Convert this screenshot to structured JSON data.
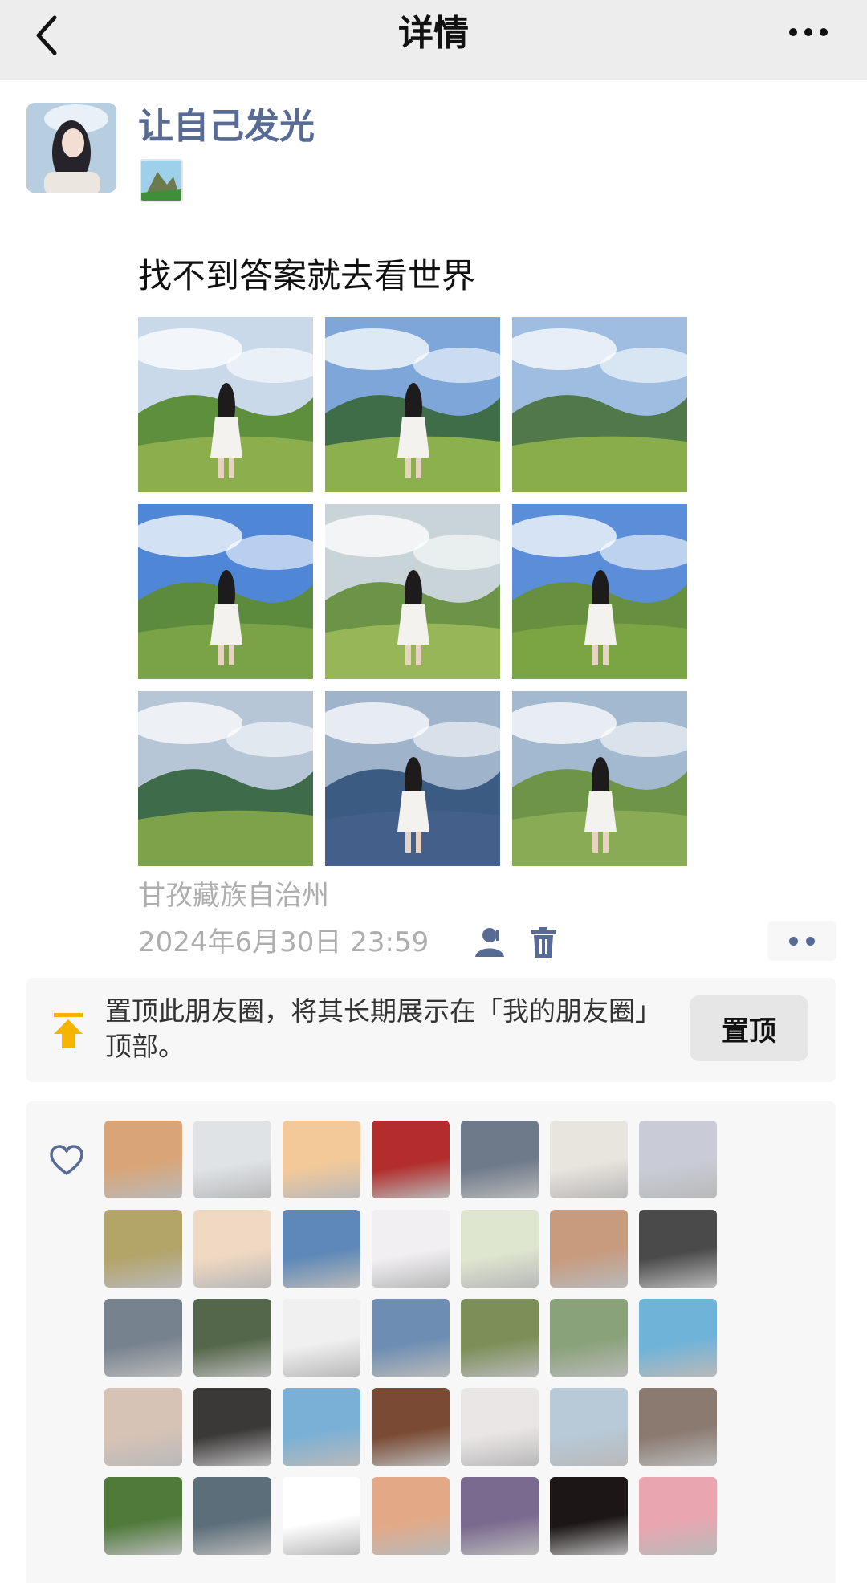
{
  "navbar": {
    "title": "详情",
    "back_icon": "chevron-left-icon",
    "more_icon": "more-dots-icon"
  },
  "post": {
    "author_name": "让自己发光",
    "status_icon": "landscape-status-icon",
    "text": "找不到答案就去看世界",
    "photos": [
      {
        "sky": "#c9d9ea",
        "hill": "#5e8f3c",
        "ground": "#8cae4c",
        "figure": true
      },
      {
        "sky": "#7ea6d9",
        "hill": "#3f6d48",
        "ground": "#8db04f",
        "figure": true
      },
      {
        "sky": "#9fbde0",
        "hill": "#50784a",
        "ground": "#88ad4a",
        "figure": false
      },
      {
        "sky": "#4f87d6",
        "hill": "#5d8b3e",
        "ground": "#7aa246",
        "figure": true
      },
      {
        "sky": "#c9d4d8",
        "hill": "#6b9446",
        "ground": "#96b658",
        "figure": true
      },
      {
        "sky": "#5b8ed8",
        "hill": "#66903f",
        "ground": "#7ba443",
        "figure": true
      },
      {
        "sky": "#b6c6d6",
        "hill": "#3e6c4a",
        "ground": "#7ea24a",
        "figure": false
      },
      {
        "sky": "#9fb3cb",
        "hill": "#3c5b82",
        "ground": "#44608a",
        "figure": true
      },
      {
        "sky": "#a3b9cf",
        "hill": "#6e9547",
        "ground": "#8aab56",
        "figure": true
      }
    ],
    "location": "甘孜藏族自治州",
    "timestamp": "2024年6月30日 23:59",
    "privacy_icon": "person-icon",
    "delete_icon": "trash-icon",
    "more_icon": "two-dots-icon"
  },
  "pin": {
    "icon": "pin-top-icon",
    "text": "置顶此朋友圈，将其长期展示在「我的朋友圈」顶部。",
    "button_label": "置顶"
  },
  "likes": {
    "icon": "heart-icon",
    "avatar_colors": [
      "#d9a577",
      "#dfe3e6",
      "#f3c99a",
      "#b22d2b",
      "#6e7a8a",
      "#e8e4de",
      "#c9ccd6",
      "#b3a468",
      "#f0d9c2",
      "#5d88b8",
      "#f1eff2",
      "#dfe6d0",
      "#c89a7e",
      "#4a4a4a",
      "#77828f",
      "#55674a",
      "#f0f0f0",
      "#6d8db3",
      "#7d8f58",
      "#8aa27a",
      "#6fb3d9",
      "#d7c3b5",
      "#3b3838",
      "#7ab0d6",
      "#7a4a34",
      "#eae6e6",
      "#b8c9d8",
      "#8a7a70",
      "#4f7a3a",
      "#5c6e7a",
      "#ffffff",
      "#e3a987",
      "#7a6a8f",
      "#1c1616",
      "#e9a6b0"
    ]
  }
}
